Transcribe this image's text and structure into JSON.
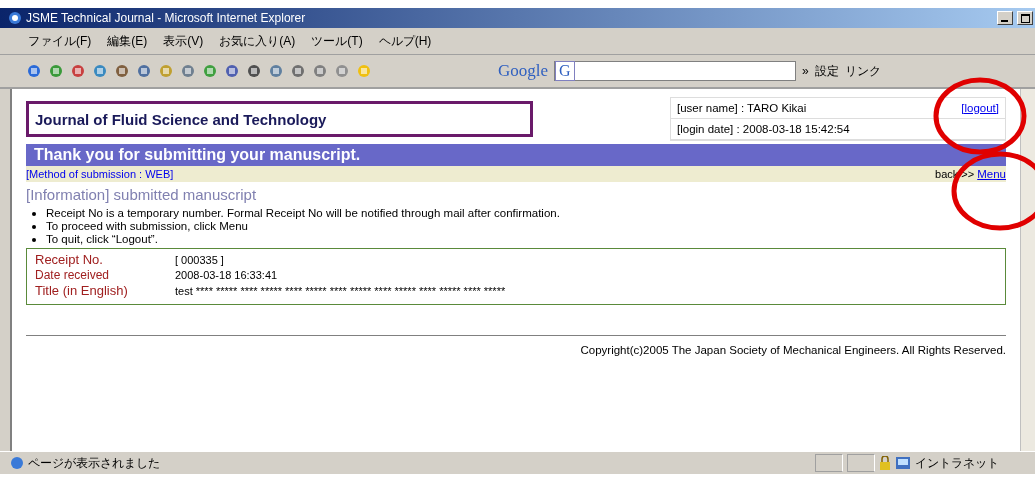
{
  "window": {
    "title": "JSME Technical Journal - Microsoft Internet Explorer"
  },
  "menu": [
    "ファイル(F)",
    "編集(E)",
    "表示(V)",
    "お気に入り(A)",
    "ツール(T)",
    "ヘルプ(H)"
  ],
  "toolbar": {
    "google_label": "Google",
    "search_prefix": "G",
    "more": "»",
    "settings": "設定",
    "links": "リンク"
  },
  "page": {
    "journal": "Journal of Fluid Science and Technology",
    "user_name": "[user name] : TARO Kikai",
    "logout": "[logout]",
    "login_date": "[login date] : 2008-03-18 15:42:54",
    "banner": "Thank you for submitting your manuscript.",
    "method": "[Method of submission : WEB]",
    "back": "back >>",
    "menu_link": "Menu",
    "heading": "[Information] submitted manuscript",
    "notes": [
      "Receipt No is a temporary number. Formal Receipt No will be notified through mail after confirmation.",
      "To proceed with submission, click Menu",
      "To quit, click “Logout”."
    ],
    "details": [
      {
        "label": "Receipt No.",
        "value": "[ 000335 ]"
      },
      {
        "label": "Date received",
        "value": "2008-03-18 16:33:41"
      },
      {
        "label": "Title (in English)",
        "value": "test **** ***** **** ***** **** ***** **** ***** **** ***** **** ***** **** *****"
      }
    ],
    "copyright": "Copyright(c)2005 The Japan Society of Mechanical Engineers. All Rights Reserved."
  },
  "status_bar": {
    "message": "ページが表示されました",
    "zone": "イントラネット"
  }
}
